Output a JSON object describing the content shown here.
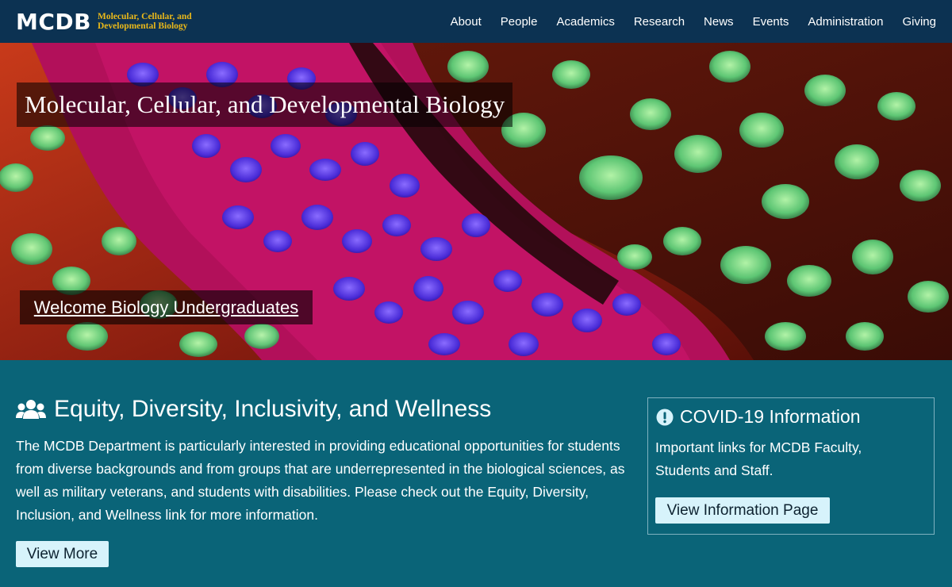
{
  "nav": {
    "logo_mark": "MCDB",
    "logo_line1": "Molecular, Cellular, and",
    "logo_line2": "Developmental Biology",
    "items": [
      "About",
      "People",
      "Academics",
      "Research",
      "News",
      "Events",
      "Administration",
      "Giving"
    ]
  },
  "hero": {
    "title": "Molecular, Cellular, and Developmental Biology",
    "link": "Welcome Biology Undergraduates"
  },
  "edi": {
    "icon": "users-icon",
    "title": "Equity, Diversity, Inclusivity, and Wellness",
    "body": "The MCDB Department is particularly interested in providing educational opportunities for students from diverse backgrounds and from groups that are underrepresented in the biological sciences, as well as military veterans, and students with disabilities. Please check out the Equity, Diversity, Inclusion, and Wellness link for more information.",
    "button": "View More"
  },
  "covid": {
    "icon": "exclamation-circle-icon",
    "title": "COVID-19 Information",
    "body": "Important links for MCDB Faculty, Students and Staff.",
    "button": "View Information Page"
  },
  "colors": {
    "nav_bg": "#0c3252",
    "content_bg": "#0a6478",
    "logo_accent": "#e9b81a",
    "button_bg": "#d7f3fb"
  }
}
